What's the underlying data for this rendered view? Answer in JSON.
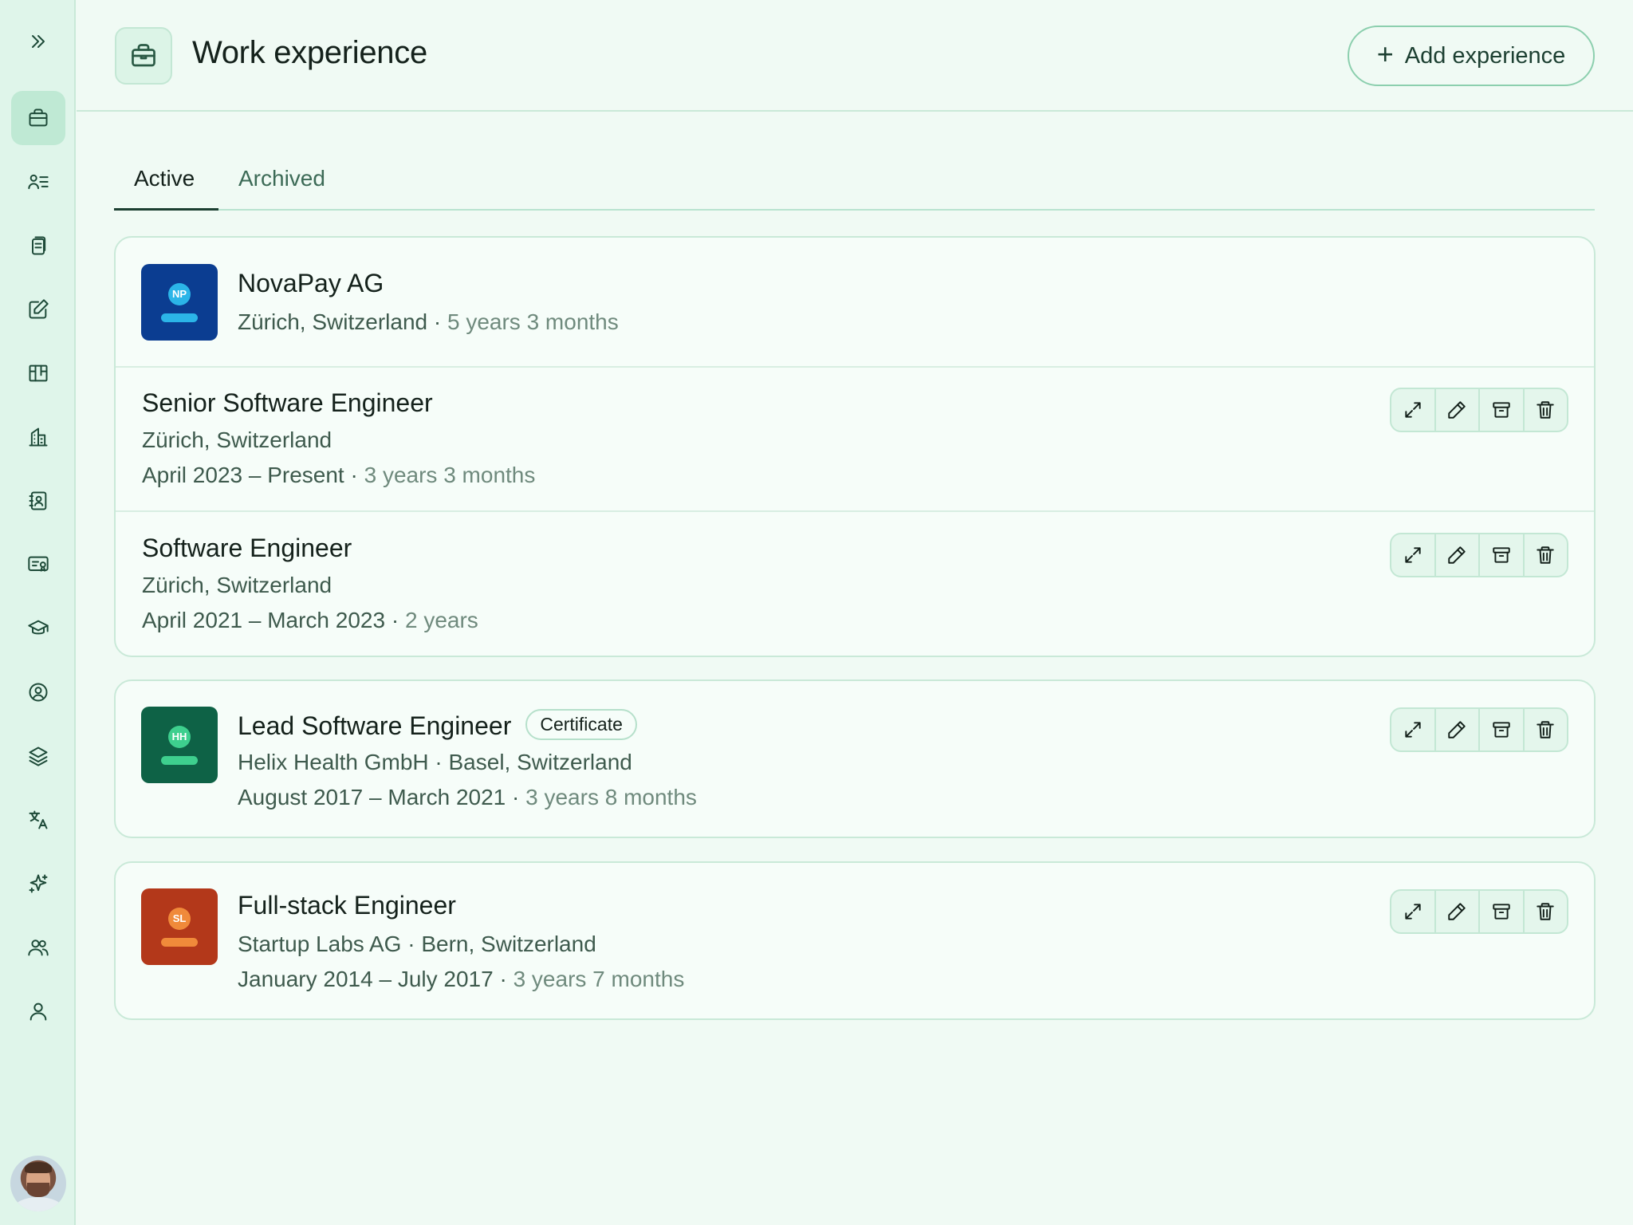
{
  "header": {
    "title": "Work experience",
    "add_button_label": "Add experience",
    "add_button_icon": "plus-icon",
    "title_icon": "briefcase-icon"
  },
  "tabs": [
    {
      "label": "Active",
      "selected": true
    },
    {
      "label": "Archived",
      "selected": false
    }
  ],
  "sidebar": {
    "toggle_icon": "double-chevron-right-icon",
    "items": [
      {
        "icon": "briefcase-icon",
        "active": true
      },
      {
        "icon": "profile-list-icon",
        "active": false
      },
      {
        "icon": "documents-icon",
        "active": false
      },
      {
        "icon": "edit-icon",
        "active": false
      },
      {
        "icon": "board-icon",
        "active": false
      },
      {
        "icon": "building-icon",
        "active": false
      },
      {
        "icon": "contacts-book-icon",
        "active": false
      },
      {
        "icon": "certificate-icon",
        "active": false
      },
      {
        "icon": "graduation-cap-icon",
        "active": false
      },
      {
        "icon": "user-circle-icon",
        "active": false
      },
      {
        "icon": "layers-icon",
        "active": false
      },
      {
        "icon": "translate-icon",
        "active": false
      },
      {
        "icon": "sparkle-icon",
        "active": false
      },
      {
        "icon": "users-icon",
        "active": false
      },
      {
        "icon": "user-icon",
        "active": false
      }
    ]
  },
  "companies": [
    {
      "name": "NovaPay AG",
      "location": "Zürich, Switzerland",
      "separator": " · ",
      "duration": "5 years 3 months",
      "logo_initials": "NP",
      "logo_colors": {
        "bg": "#0b3d91",
        "dot": "#2bb5e8",
        "bar": "#2bb5e8"
      },
      "roles": [
        {
          "title": "Senior Software Engineer",
          "location": "Zürich, Switzerland",
          "dates": "April 2023 – Present",
          "separator": " · ",
          "duration": "3 years 3 months"
        },
        {
          "title": "Software Engineer",
          "location": "Zürich, Switzerland",
          "dates": "April 2021 – March 2023",
          "separator": " · ",
          "duration": "2 years"
        }
      ]
    },
    {
      "title": "Lead Software Engineer",
      "badge": "Certificate",
      "company_location": "Helix Health GmbH · Basel, Switzerland",
      "dates": "August 2017 – March 2021",
      "separator": " · ",
      "duration": "3 years 8 months",
      "logo_initials": "HH",
      "logo_colors": {
        "bg": "#0e6246",
        "dot": "#3ecf8e",
        "bar": "#3ecf8e"
      }
    },
    {
      "title": "Full-stack Engineer",
      "company_location": "Startup Labs AG · Bern, Switzerland",
      "dates": "January 2014 – July 2017",
      "separator": " · ",
      "duration": "3 years 7 months",
      "logo_initials": "SL",
      "logo_colors": {
        "bg": "#b3381a",
        "dot": "#f08a3a",
        "bar": "#f08a3a"
      }
    }
  ],
  "action_icons": [
    "expand-icon",
    "pencil-icon",
    "archive-icon",
    "trash-icon"
  ]
}
